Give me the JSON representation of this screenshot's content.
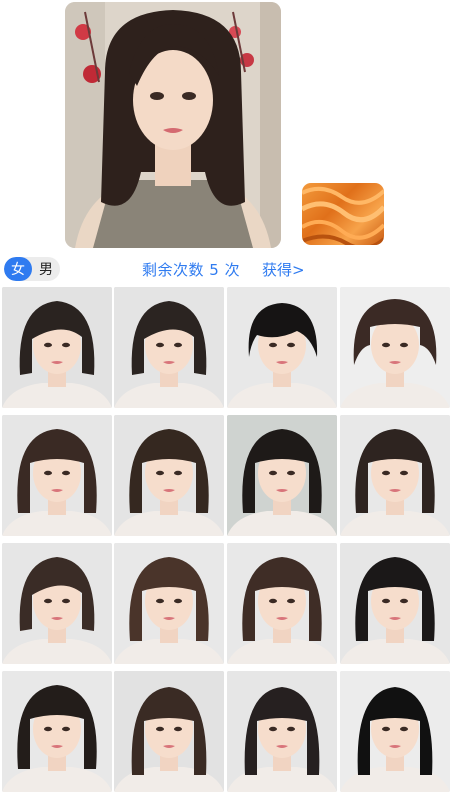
{
  "preview": {
    "photo_name": "selected-face-photo",
    "swatch_color_name": "orange-hair-color",
    "swatch_colors": [
      "#f39a3c",
      "#e0701a",
      "#c95b12"
    ]
  },
  "gender_toggle": {
    "female_label": "女",
    "male_label": "男",
    "selected": "female"
  },
  "remaining": {
    "text": "剩余次数 5 次",
    "count": 5
  },
  "obtain_link": "获得>",
  "accent_color": "#2f7bf0",
  "hairstyles": [
    {
      "style": "short-bob",
      "bg": "#e2e2e2",
      "hair": "#2a2320"
    },
    {
      "style": "short-bob",
      "bg": "#e4e4e4",
      "hair": "#2b2421"
    },
    {
      "style": "pixie",
      "bg": "#e8e8e8",
      "hair": "#161414"
    },
    {
      "style": "mushroom",
      "bg": "#eeeeee",
      "hair": "#3b2a25"
    },
    {
      "style": "bob-bangs",
      "bg": "#e6e6e6",
      "hair": "#3a2a24"
    },
    {
      "style": "bob-bangs",
      "bg": "#e4e4e4",
      "hair": "#352820"
    },
    {
      "style": "bob-bangs",
      "bg": "#cfd3d0",
      "hair": "#1e1a18"
    },
    {
      "style": "bob-bangs",
      "bg": "#e8e8e8",
      "hair": "#2e2420"
    },
    {
      "style": "short-bob",
      "bg": "#e6e6e6",
      "hair": "#3a2c26"
    },
    {
      "style": "bob-bangs",
      "bg": "#e8e8e8",
      "hair": "#4a342a"
    },
    {
      "style": "bob-bangs",
      "bg": "#e8e8e8",
      "hair": "#3f2d26"
    },
    {
      "style": "bob-bangs",
      "bg": "#e6e6e6",
      "hair": "#1b1818"
    },
    {
      "style": "bob-bangs",
      "bg": "#e8e8e8",
      "hair": "#231d1a"
    },
    {
      "style": "straight-bangs",
      "bg": "#e2e2e2",
      "hair": "#3a2b24"
    },
    {
      "style": "straight-bangs",
      "bg": "#e6e6e6",
      "hair": "#262020"
    },
    {
      "style": "straight-bangs",
      "bg": "#ececec",
      "hair": "#111111"
    }
  ]
}
